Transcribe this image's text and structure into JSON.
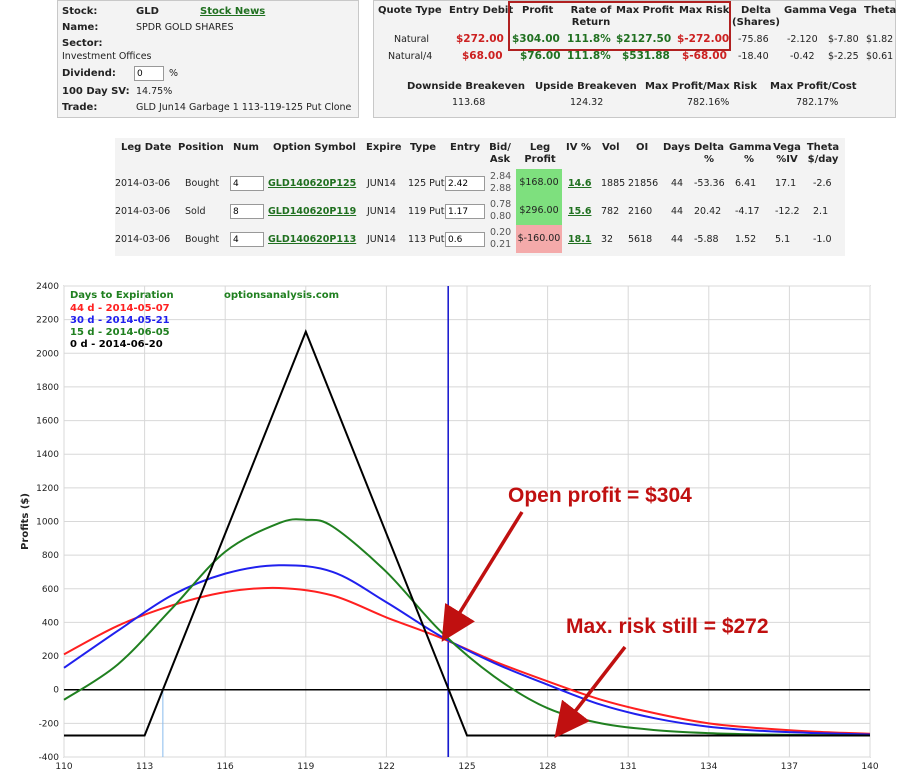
{
  "stock_panel": {
    "stock_label": "Stock:",
    "stock_value": "GLD",
    "stock_news": "Stock News",
    "name_label": "Name:",
    "name_value": "SPDR GOLD SHARES",
    "sector_label": "Sector:",
    "sector_value": "Investment Offices",
    "dividend_label": "Dividend:",
    "dividend_value": "0",
    "dividend_unit": "%",
    "sv_label": "100 Day SV:",
    "sv_value": "14.75%",
    "trade_label": "Trade:",
    "trade_value": "GLD Jun14 Garbage 1 113-119-125 Put Clone"
  },
  "quote_panel": {
    "headers": [
      "Quote Type",
      "Entry Debit",
      "Profit",
      "Rate of Return",
      "Max Profit",
      "Max Risk",
      "Delta (Shares)",
      "Gamma",
      "Vega",
      "Theta"
    ],
    "rows": [
      {
        "type": "Natural",
        "entry": "$272.00",
        "profit": "$304.00",
        "ror": "111.8%",
        "max_profit": "$2127.50",
        "max_risk": "$-272.00",
        "delta": "-75.86",
        "gamma": "-2.120",
        "vega": "$-7.80",
        "theta": "$1.82"
      },
      {
        "type": "Natural/4",
        "entry": "$68.00",
        "profit": "$76.00",
        "ror": "111.8%",
        "max_profit": "$531.88",
        "max_risk": "$-68.00",
        "delta": "-18.40",
        "gamma": "-0.42",
        "vega": "$-2.25",
        "theta": "$0.61"
      }
    ],
    "stats_headers": [
      "Downside Breakeven",
      "Upside Breakeven",
      "Max Profit/Max Risk",
      "Max Profit/Cost"
    ],
    "stats_values": [
      "113.68",
      "124.32",
      "782.16%",
      "782.17%"
    ]
  },
  "legs": {
    "headers": [
      "Leg Date",
      "Position",
      "Num",
      "Option Symbol",
      "Expire",
      "Type",
      "Entry",
      "Bid/ Ask",
      "Leg Profit",
      "IV %",
      "Vol",
      "OI",
      "Days",
      "Delta %",
      "Gamma %",
      "Vega %IV",
      "Theta $/day"
    ],
    "rows": [
      {
        "date": "2014-03-06",
        "position": "Bought",
        "num": "4",
        "symbol": "GLD140620P125",
        "expire": "JUN14",
        "type": "125 Put",
        "entry": "2.42",
        "bid": "2.84",
        "ask": "2.88",
        "leg_profit": "$168.00",
        "iv": "14.6",
        "vol": "1885",
        "oi": "21856",
        "days": "44",
        "delta": "-53.36",
        "gamma": "6.41",
        "vega": "17.1",
        "theta": "-2.6"
      },
      {
        "date": "2014-03-06",
        "position": "Sold",
        "num": "8",
        "symbol": "GLD140620P119",
        "expire": "JUN14",
        "type": "119 Put",
        "entry": "1.17",
        "bid": "0.78",
        "ask": "0.80",
        "leg_profit": "$296.00",
        "iv": "15.6",
        "vol": "782",
        "oi": "2160",
        "days": "44",
        "delta": "20.42",
        "gamma": "-4.17",
        "vega": "-12.2",
        "theta": "2.1"
      },
      {
        "date": "2014-03-06",
        "position": "Bought",
        "num": "4",
        "symbol": "GLD140620P113",
        "expire": "JUN14",
        "type": "113 Put",
        "entry": "0.6",
        "bid": "0.20",
        "ask": "0.21",
        "leg_profit": "$-160.00",
        "iv": "18.1",
        "vol": "32",
        "oi": "5618",
        "days": "44",
        "delta": "-5.88",
        "gamma": "1.52",
        "vega": "5.1",
        "theta": "-1.0"
      }
    ]
  },
  "chart": {
    "legend_title": "Days to Expiration",
    "site": "optionsanalysis.com",
    "ylabel": "Profits ($)",
    "annotation_open": "Open profit = $304",
    "annotation_risk": "Max. risk still = $272"
  },
  "colors": {
    "series_44": "#ff2020",
    "series_30": "#2020ee",
    "series_15": "#208020",
    "series_0": "#000000",
    "annotation": "#c01010",
    "positive_cell": "#7ee07e",
    "negative_cell": "#f4aaaa"
  },
  "chart_data": {
    "type": "line",
    "xlim": [
      110,
      140
    ],
    "ylim": [
      -400,
      2400
    ],
    "x_ticks": [
      110,
      113,
      116,
      119,
      122,
      125,
      128,
      131,
      134,
      137,
      140
    ],
    "y_ticks": [
      -400,
      -200,
      0,
      200,
      400,
      600,
      800,
      1000,
      1200,
      1400,
      1600,
      1800,
      2000,
      2200,
      2400
    ],
    "grid": true,
    "legend_position": "top-left",
    "series": [
      {
        "name": "44 d  - 2014-05-07",
        "x": [
          110,
          112,
          114,
          116,
          118,
          120,
          122,
          124,
          126,
          128,
          130,
          132,
          134,
          136,
          138,
          140
        ],
        "y": [
          210,
          380,
          500,
          580,
          605,
          560,
          430,
          310,
          170,
          50,
          -60,
          -140,
          -200,
          -230,
          -250,
          -262
        ]
      },
      {
        "name": "30 d  - 2014-05-21",
        "x": [
          110,
          112,
          114,
          116,
          118,
          120,
          122,
          124,
          126,
          128,
          130,
          132,
          134,
          136,
          138,
          140
        ],
        "y": [
          130,
          350,
          560,
          690,
          740,
          700,
          520,
          320,
          160,
          30,
          -90,
          -170,
          -220,
          -245,
          -258,
          -266
        ]
      },
      {
        "name": "15 d  - 2014-06-05",
        "x": [
          110,
          112,
          114,
          116,
          118,
          119,
          120,
          122,
          124,
          126,
          128,
          130,
          132,
          134,
          136,
          138,
          140
        ],
        "y": [
          -60,
          150,
          480,
          820,
          990,
          1010,
          970,
          700,
          350,
          80,
          -110,
          -200,
          -240,
          -258,
          -266,
          -270,
          -272
        ]
      },
      {
        "name": "0 d   - 2014-06-20",
        "x": [
          110,
          113,
          119,
          125,
          140
        ],
        "y": [
          -272,
          -272,
          2128,
          -272,
          -272
        ]
      }
    ],
    "vertical_lines": [
      {
        "x": 124.3,
        "label": ""
      }
    ]
  }
}
